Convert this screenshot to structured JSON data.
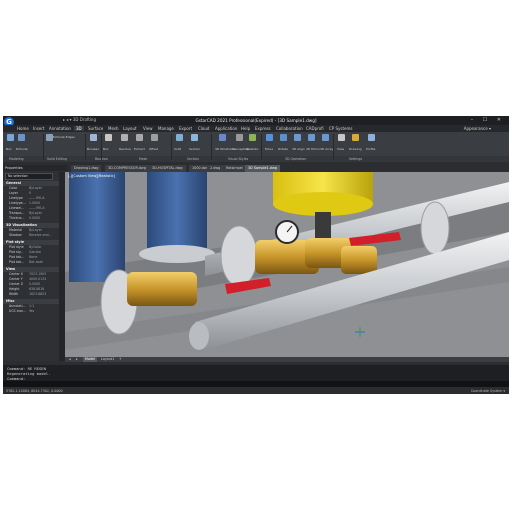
{
  "app": {
    "title": "GstarCAD 2021 Professional(Expired) - [3D Sample1.dwg]",
    "quick_access": "▸ ◂ ▾ 3D Drafting",
    "logo_letter": "G",
    "window_controls": "– ☐ ✕",
    "appearance": "Appearance ▾"
  },
  "ribbon_tabs": [
    "Home",
    "Insert",
    "Annotation",
    "3D",
    "Surface",
    "Mesh",
    "Layout",
    "View",
    "Manage",
    "Export",
    "Cloud",
    "Application",
    "Help",
    "Express",
    "Collaboration",
    "CADprofi",
    "CP Systems"
  ],
  "ribbon_tools": [
    "Box",
    "Extrude",
    "Extrude Edges",
    "Boolean",
    "Box",
    "Revolve",
    "Extract",
    "Offset",
    "Solid",
    "Section",
    "3D Wireframe",
    "Conceptual",
    "Realistic",
    "Move",
    "Rotate",
    "3D Align",
    "3D Mirror",
    "3D Array",
    "View",
    "Drawing",
    "Profile"
  ],
  "ribbon_panels": [
    "Modeling",
    "Solid Editing",
    "Boolean",
    "Mesh",
    "Section",
    "Visual Styles",
    "3D Operation",
    "Settings"
  ],
  "doc_tabs": [
    "Drawing1.dwg",
    "3D-COMPRESSOR.dwg",
    "3D-HOSPITAL.dwg",
    "1000.dwg",
    "2.dwg",
    "Rotsimpel",
    "3D Sample1.dwg"
  ],
  "active_doc_tab": "3D Sample1.dwg",
  "properties": {
    "header": "Properties",
    "selection": "No selection",
    "sections": [
      {
        "title": "General",
        "rows": [
          [
            "Color",
            "ByLayer"
          ],
          [
            "Layer",
            "0"
          ],
          [
            "Linetype",
            "—— BYLA"
          ],
          [
            "Linetype...",
            "1.0000"
          ],
          [
            "Linewei...",
            "—— BYLA"
          ],
          [
            "Transpa...",
            "ByLayer"
          ],
          [
            "Thickne...",
            "0.0000"
          ]
        ]
      },
      {
        "title": "3D Visualization",
        "rows": [
          [
            "Material",
            "ByLayer"
          ],
          [
            "Shadow",
            "Receive and..."
          ]
        ]
      },
      {
        "title": "Plot style",
        "rows": [
          [
            "Plot style",
            "ByColor"
          ],
          [
            "Plot sty...",
            "Ganzka"
          ],
          [
            "Plot tab...",
            "None"
          ],
          [
            "Plot tab...",
            "Not avail"
          ]
        ]
      },
      {
        "title": "View",
        "rows": [
          [
            "Center X",
            "7023.1905"
          ],
          [
            "Center Y",
            "4000.0134"
          ],
          [
            "Center Z",
            "0.0000"
          ],
          [
            "Height",
            "638.8818"
          ],
          [
            "Width",
            "1623.8823"
          ]
        ]
      },
      {
        "title": "Misc",
        "rows": [
          [
            "Annotati...",
            "1:1"
          ],
          [
            "UCS icon...",
            "Yes"
          ]
        ]
      }
    ]
  },
  "viewport_label": "[-][Custom View][Realistic]",
  "layout_tabs": [
    "◂",
    "▸",
    "Model",
    "Layout1",
    "+"
  ],
  "active_layout": "Model",
  "command": {
    "lines": [
      "Command: RE REGEN",
      "Regenerating model.",
      "Command:"
    ],
    "prompt": ""
  },
  "status": {
    "coordinates": "5762.1.10084, 6044.7302, 0.0000",
    "coord_system": "Coordinate System ▾"
  },
  "colors": {
    "accent": "#1f6fd1",
    "pipe": "#c9ccd0",
    "brass": "#c8962a",
    "handle": "#d21f2a",
    "tank": "#e9d21a",
    "pump": "#3a5f9a"
  }
}
